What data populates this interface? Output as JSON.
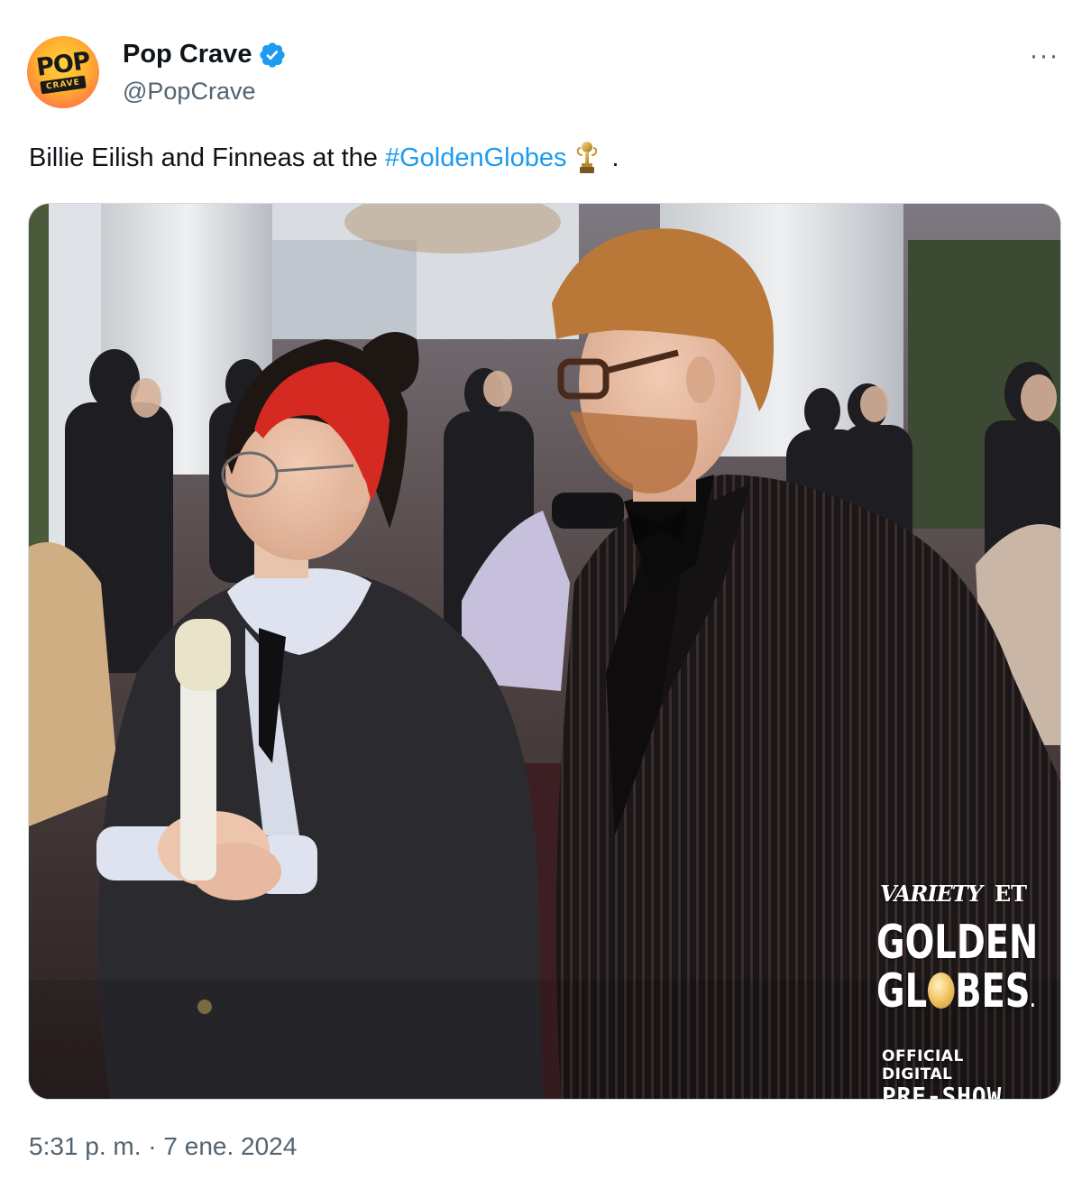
{
  "author": {
    "display_name": "Pop Crave",
    "handle": "@PopCrave",
    "verified": true,
    "avatar": {
      "text_top": "POP",
      "text_bottom": "CRAVE"
    }
  },
  "more_icon": "more-horizontal-icon",
  "tweet": {
    "text_prefix": "Billie Eilish and Finneas at the ",
    "hashtag": "#GoldenGlobes",
    "emoji": "trophy",
    "text_suffix": " ."
  },
  "media": {
    "overlay": {
      "brand_left": "VARIETY",
      "brand_right": "ET",
      "title_line1": "GOLDEN",
      "title_line2_start": "GL",
      "title_line2_end": "BES",
      "trademark": ".",
      "subtitle_line1": "OFFICIAL DIGITAL",
      "subtitle_line2": "PRE-SHOW"
    }
  },
  "timestamp": "5:31 p. m. · 7 ene. 2024",
  "colors": {
    "link": "#1d9bf0",
    "secondary_text": "#536471",
    "verified_badge": "#1d9bf0",
    "hair_red": "#d42a22"
  }
}
